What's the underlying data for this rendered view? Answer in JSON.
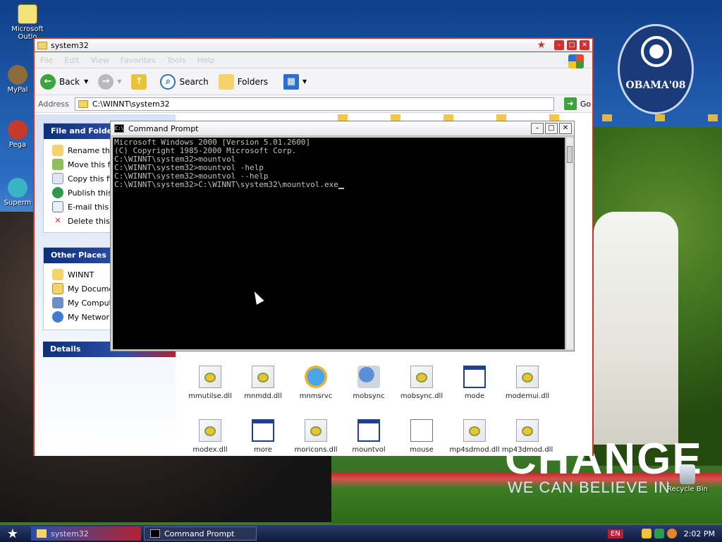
{
  "desktop": {
    "icons": [
      {
        "label": "Microsoft Outlo"
      },
      {
        "label": "MyPal"
      },
      {
        "label": "Pega"
      },
      {
        "label": "Superm"
      },
      {
        "label": "Recycle Bin"
      }
    ],
    "wallpaper_text": {
      "logo": "OBAMA'08",
      "change": "CHANGE",
      "believe": "WE CAN BELIEVE IN"
    }
  },
  "explorer": {
    "title": "system32",
    "menu": [
      "File",
      "Edit",
      "View",
      "Favorites",
      "Tools",
      "Help"
    ],
    "toolbar": {
      "back": "Back",
      "search": "Search",
      "folders": "Folders"
    },
    "address_label": "Address",
    "address_value": "C:\\WINNT\\system32",
    "go_label": "Go",
    "file_folder_tasks": {
      "title": "File and Folder Tasks",
      "items": [
        "Rename this file",
        "Move this file",
        "Copy this file",
        "Publish this file",
        "E-mail this file",
        "Delete this file"
      ]
    },
    "other_places": {
      "title": "Other Places",
      "items": [
        "WINNT",
        "My Documents",
        "My Computer",
        "My Network Places"
      ]
    },
    "details": {
      "title": "Details"
    },
    "files_row1": [
      "mmutilse.dll",
      "mnmdd.dll",
      "mnmsrvc",
      "mobsync",
      "mobsync.dll",
      "mode",
      "modemui.dll"
    ],
    "files_row2": [
      "modex.dll",
      "more",
      "moricons.dll",
      "mountvol",
      "mouse",
      "mp4sdmod.dll",
      "mp43dmod.dll"
    ]
  },
  "cmd": {
    "title": "Command Prompt",
    "lines": [
      "Microsoft Windows 2000 [Version 5.01.2600]",
      "(C) Copyright 1985-2000 Microsoft Corp.",
      "",
      "C:\\WINNT\\system32>mountvol",
      "",
      "",
      "C:\\WINNT\\system32>mountvol -help",
      "",
      "",
      "C:\\WINNT\\system32>mountvol --help",
      "",
      "",
      "C:\\WINNT\\system32>C:\\WINNT\\system32\\mountvol.exe"
    ]
  },
  "taskbar": {
    "tasks": [
      {
        "label": "system32"
      },
      {
        "label": "Command Prompt"
      }
    ],
    "language": "EN",
    "clock": "2:02 PM"
  }
}
